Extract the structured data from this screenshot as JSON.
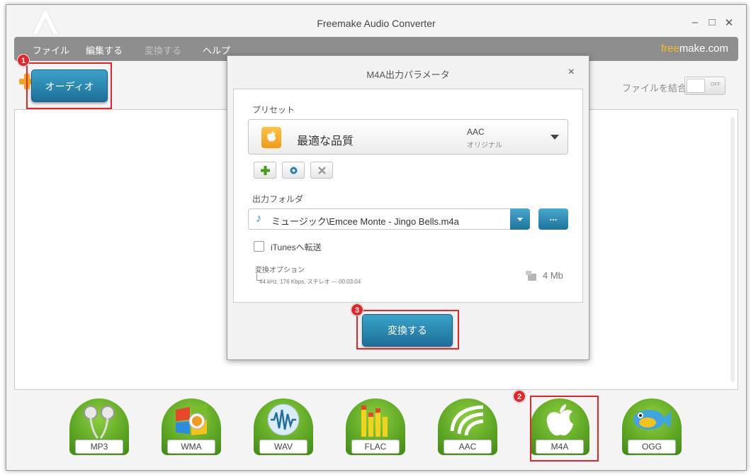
{
  "window": {
    "title": "Freemake Audio Converter",
    "controls": [
      "–",
      "□",
      "✕"
    ]
  },
  "menu": {
    "items": [
      {
        "label": "ファイル",
        "enabled": true
      },
      {
        "label": "編集する",
        "enabled": true
      },
      {
        "label": "変換する",
        "enabled": false
      },
      {
        "label": "ヘルプ",
        "enabled": true
      }
    ],
    "brand_free": "free",
    "brand_rest": "make.com"
  },
  "toolbar": {
    "audio_button": "オーディオ",
    "merge_label": "ファイルを結合",
    "merge_state": "OFF"
  },
  "formats": [
    {
      "label": "MP3",
      "icon": "earphones-icon",
      "color": "#5aa11c"
    },
    {
      "label": "WMA",
      "icon": "windows-media-icon",
      "color": "#5aa11c"
    },
    {
      "label": "WAV",
      "icon": "waveform-icon",
      "color": "#5aa11c"
    },
    {
      "label": "FLAC",
      "icon": "equalizer-icon",
      "color": "#5aa11c"
    },
    {
      "label": "AAC",
      "icon": "aac-waves-icon",
      "color": "#5aa11c"
    },
    {
      "label": "M4A",
      "icon": "apple-icon",
      "color": "#5aa11c"
    },
    {
      "label": "OGG",
      "icon": "fish-icon",
      "color": "#5aa11c"
    }
  ],
  "steps": [
    "1",
    "2",
    "3"
  ],
  "dialog": {
    "title": "M4A出力パラメータ",
    "close": "×",
    "preset_label": "プリセット",
    "preset_name": "最適な品質",
    "preset_codec": "AAC",
    "preset_sub": "オリジナル",
    "output_folder_label": "出力フォルダ",
    "output_folder_value": "ミュージック\\Emcee Monte - Jingo Bells.m4a",
    "browse_label": "...",
    "itunes_label": "iTunesへ転送",
    "itunes_checked": false,
    "options_title": "変換オプション",
    "options_detail": "44 kHz, 176 Kbps, ステレオ — 00:03:04",
    "size": "4 Mb",
    "convert_button": "変換する"
  },
  "colors": {
    "accent_blue": "#1d6f98",
    "format_green": "#5aa11c",
    "highlight_red": "#e4262b",
    "brand_orange": "#f6b928"
  }
}
